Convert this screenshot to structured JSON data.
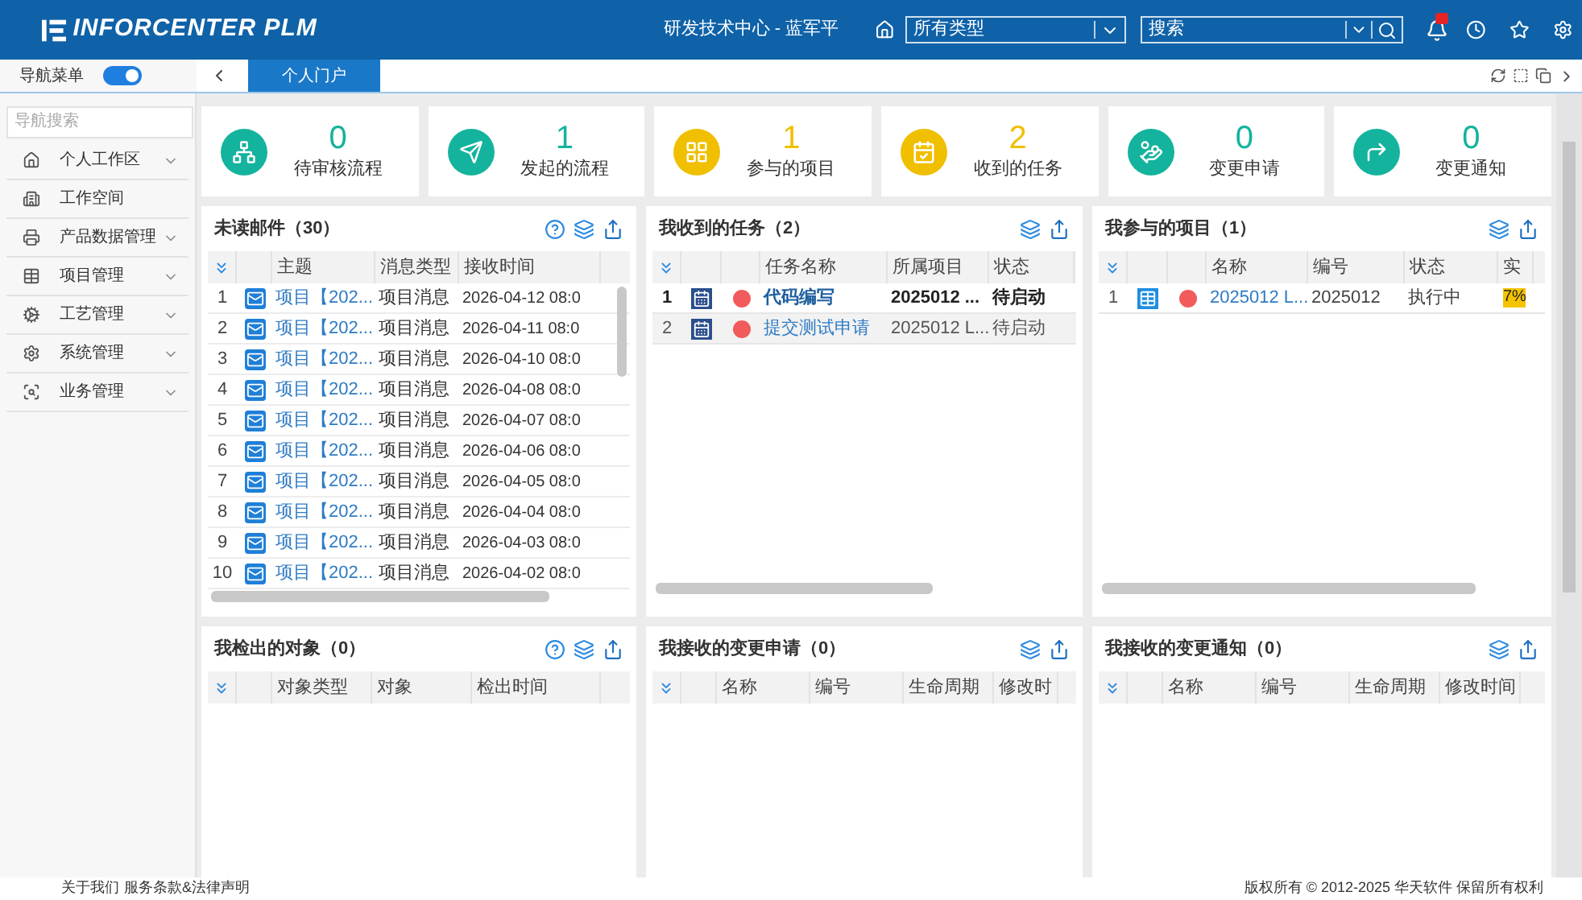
{
  "header": {
    "logo": "INFORCENTER PLM",
    "user": "研发技术中心 - 蓝军平",
    "type_select": "所有类型",
    "search": {
      "placeholder": "搜索"
    }
  },
  "nav": {
    "label": "导航菜单",
    "on": true
  },
  "tabs": [
    {
      "label": "个人门户",
      "selected": true
    }
  ],
  "sidebar": {
    "search": {
      "placeholder": "导航搜索"
    },
    "items": [
      {
        "label": "个人工作区",
        "kind": "home",
        "expandable": true
      },
      {
        "label": "工作空间",
        "kind": "building",
        "expandable": false
      },
      {
        "label": "产品数据管理",
        "kind": "printer",
        "expandable": true
      },
      {
        "label": "项目管理",
        "kind": "table",
        "expandable": true
      },
      {
        "label": "工艺管理",
        "kind": "cog",
        "expandable": true
      },
      {
        "label": "系统管理",
        "kind": "settings",
        "expandable": true
      },
      {
        "label": "业务管理",
        "kind": "scan",
        "expandable": true
      }
    ]
  },
  "stats": [
    {
      "value": "0",
      "label": "待审核流程",
      "kind": "flow",
      "color": "#14b39d"
    },
    {
      "value": "1",
      "label": "发起的流程",
      "kind": "send",
      "color": "#14b39d"
    },
    {
      "value": "1",
      "label": "参与的项目",
      "kind": "grid",
      "color": "#f0bf00"
    },
    {
      "value": "2",
      "label": "收到的任务",
      "kind": "calendar",
      "color": "#f0bf00"
    },
    {
      "value": "0",
      "label": "变更申请",
      "kind": "hand",
      "color": "#14b39d"
    },
    {
      "value": "0",
      "label": "变更通知",
      "kind": "forward",
      "color": "#14b39d"
    }
  ],
  "panels": [
    {
      "kind": "mail",
      "title": "未读邮件（30）",
      "help": true,
      "columns": [
        "主题",
        "消息类型",
        "接收时间"
      ],
      "rows": [
        {
          "num": "1",
          "subject": "项目【202...",
          "type": "项目消息",
          "time": "2026-04-12 08:0"
        },
        {
          "num": "2",
          "subject": "项目【202...",
          "type": "项目消息",
          "time": "2026-04-11 08:0"
        },
        {
          "num": "3",
          "subject": "项目【202...",
          "type": "项目消息",
          "time": "2026-04-10 08:0"
        },
        {
          "num": "4",
          "subject": "项目【202...",
          "type": "项目消息",
          "time": "2026-04-08 08:0"
        },
        {
          "num": "5",
          "subject": "项目【202...",
          "type": "项目消息",
          "time": "2026-04-07 08:0"
        },
        {
          "num": "6",
          "subject": "项目【202...",
          "type": "项目消息",
          "time": "2026-04-06 08:0"
        },
        {
          "num": "7",
          "subject": "项目【202...",
          "type": "项目消息",
          "time": "2026-04-05 08:0"
        },
        {
          "num": "8",
          "subject": "项目【202...",
          "type": "项目消息",
          "time": "2026-04-04 08:0"
        },
        {
          "num": "9",
          "subject": "项目【202...",
          "type": "项目消息",
          "time": "2026-04-03 08:0"
        },
        {
          "num": "10",
          "subject": "项目【202...",
          "type": "项目消息",
          "time": "2026-04-02 08:0"
        }
      ]
    },
    {
      "kind": "task",
      "title": "我收到的任务（2）",
      "help": false,
      "columns": [
        "任务名称",
        "所属项目",
        "状态"
      ],
      "rows": [
        {
          "num": "1",
          "name": "代码编写",
          "project": "2025012 ...",
          "status": "待启动",
          "bold": true,
          "selected": false,
          "color": "#f25b5b"
        },
        {
          "num": "2",
          "name": "提交测试申请",
          "project": "2025012 L...",
          "status": "待启动",
          "bold": false,
          "selected": true,
          "color": "#f25b5b"
        }
      ]
    },
    {
      "kind": "project",
      "title": "我参与的项目（1）",
      "help": false,
      "columns": [
        "名称",
        "编号",
        "状态",
        "实"
      ],
      "rows": [
        {
          "num": "1",
          "name": "2025012 L...",
          "code": "2025012",
          "status": "执行中",
          "progress": "7%",
          "color": "#f25b5b"
        }
      ]
    },
    {
      "kind": "empty",
      "title": "我检出的对象（0）",
      "help": true,
      "columns": [
        "对象类型",
        "对象",
        "检出时间"
      ]
    },
    {
      "kind": "empty",
      "title": "我接收的变更申请（0）",
      "help": false,
      "columns": [
        "名称",
        "编号",
        "生命周期",
        "修改时"
      ]
    },
    {
      "kind": "empty",
      "title": "我接收的变更通知（0）",
      "help": false,
      "columns": [
        "名称",
        "编号",
        "生命周期",
        "修改时间"
      ]
    }
  ],
  "footer": {
    "links": [
      "关于我们",
      "服务条款&法律声明"
    ],
    "copyright": "版权所有 © 2012-2025 华天软件 保留所有权利"
  }
}
